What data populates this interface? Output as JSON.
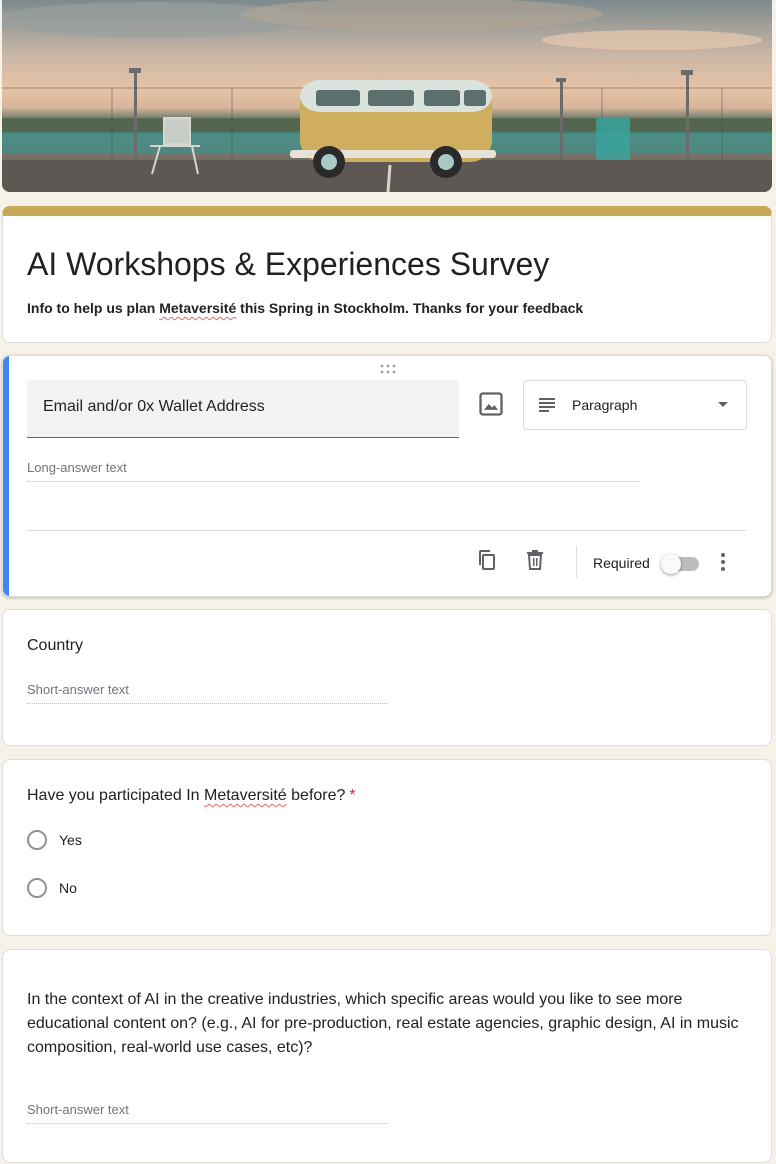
{
  "form": {
    "title": "AI Workshops & Experiences Survey",
    "description_pre": "Info to help us plan ",
    "description_brand": "Metaversité",
    "description_post": " this Spring in Stockholm. Thanks for your feedback",
    "accent_color": "#c8a95a",
    "active_color": "#4285f4"
  },
  "active_question": {
    "title": "Email and/or  0x Wallet Address",
    "type_label": "Paragraph",
    "answer_hint": "Long-answer text",
    "required_label": "Required",
    "required": false,
    "icons": [
      "drag-handle-icon",
      "image-icon",
      "paragraph-lines-icon",
      "dropdown-caret-icon",
      "duplicate-icon",
      "delete-icon",
      "more-vert-icon"
    ]
  },
  "questions": [
    {
      "title": "Country",
      "answer_hint": "Short-answer text"
    },
    {
      "title_pre": "Have you participated In ",
      "title_brand": "Metaversité",
      "title_post": " before?",
      "required_mark": "*",
      "options": [
        "Yes",
        "No"
      ]
    },
    {
      "title": "In the context of AI in the creative industries, which specific areas would you like to see more educational content on? (e.g., AI for pre-production, real estate agencies, graphic design, AI in music composition, real-world use cases, etc)?",
      "answer_hint": "Short-answer text"
    }
  ]
}
